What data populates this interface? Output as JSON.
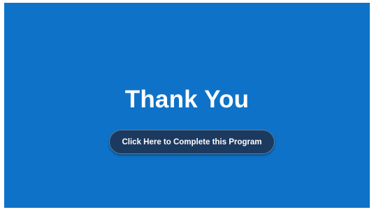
{
  "slide": {
    "title": "Thank You",
    "cta_label": "Click Here to Complete this Program",
    "background_color": "#0e73c8",
    "button_color": "#1c3a5f"
  }
}
